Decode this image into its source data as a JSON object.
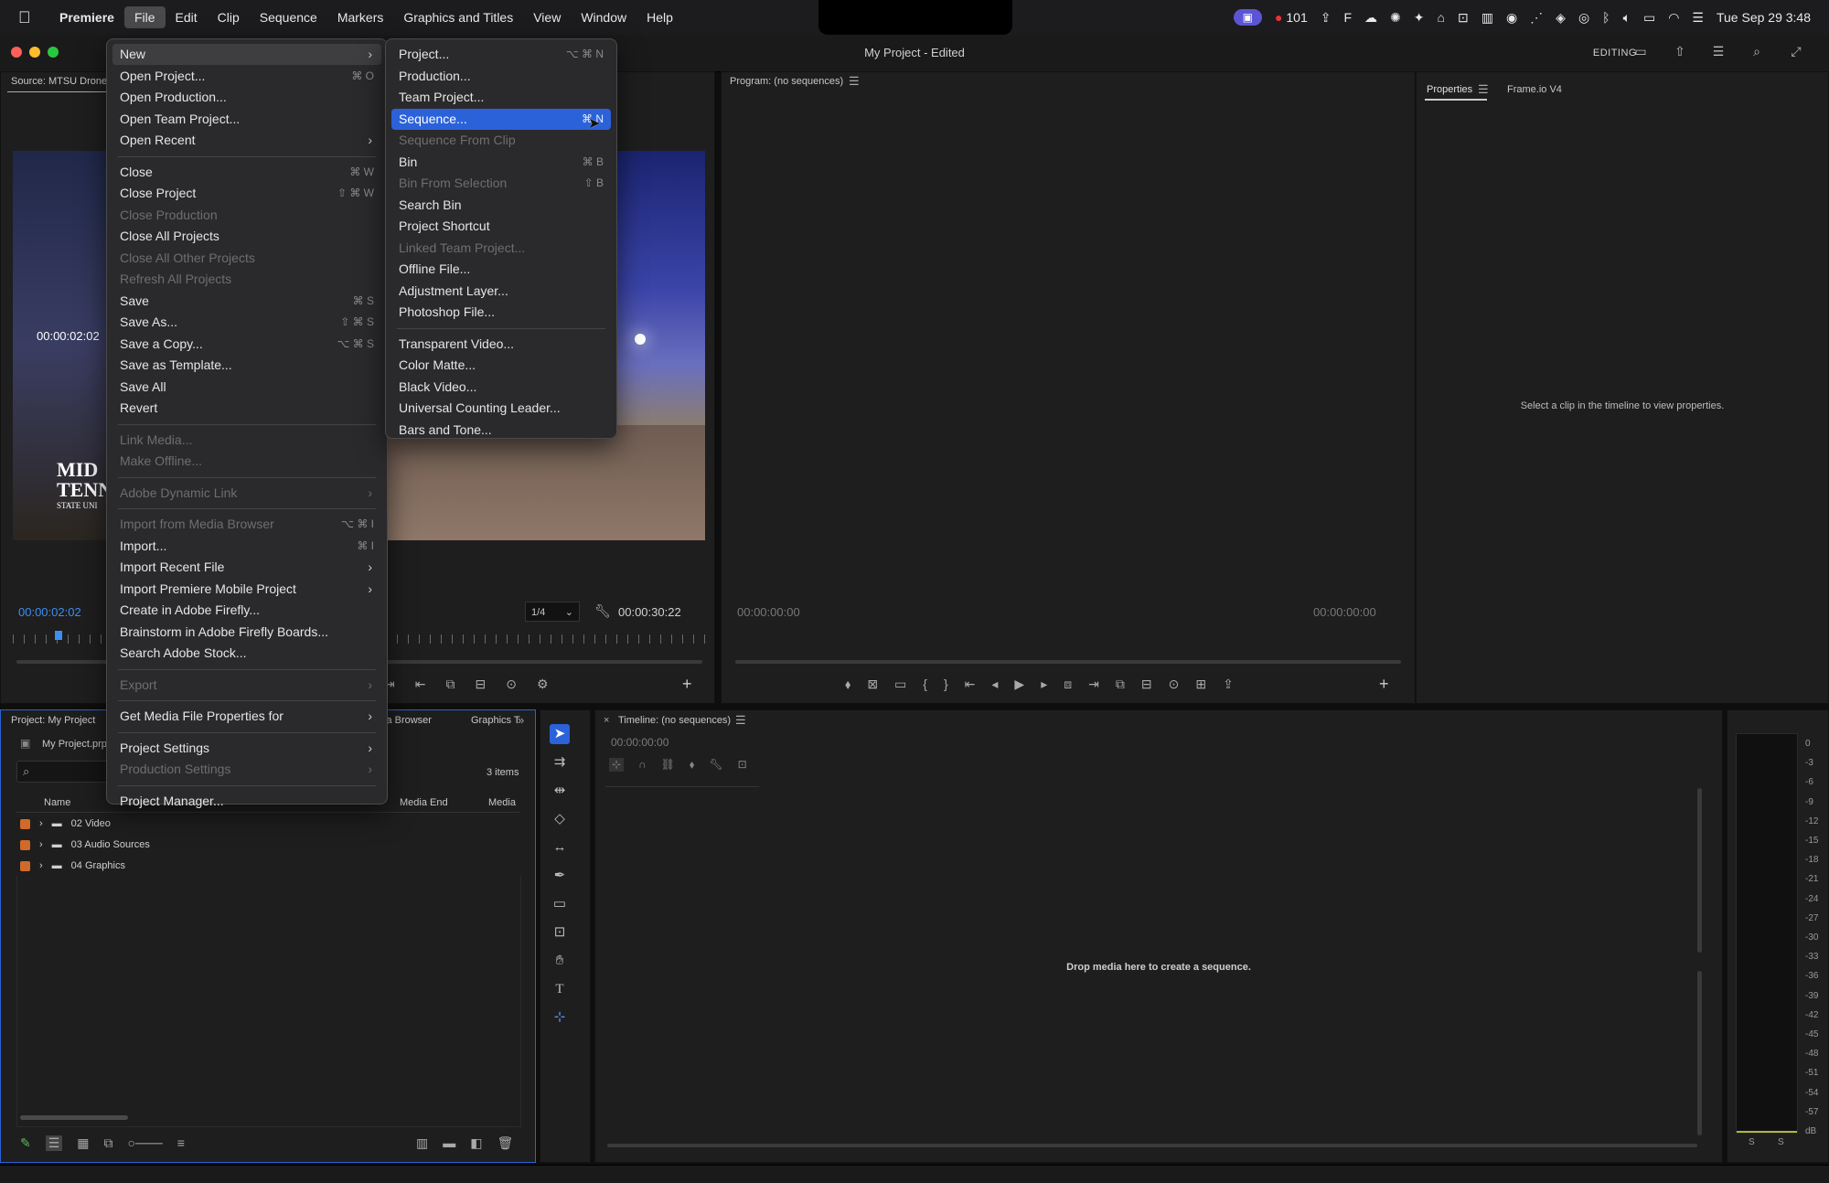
{
  "menubar": {
    "app": "Premiere",
    "items": [
      "File",
      "Edit",
      "Clip",
      "Sequence",
      "Markers",
      "Graphics and Titles",
      "View",
      "Window",
      "Help"
    ],
    "active": "File",
    "status": {
      "rec_count": "101",
      "datetime": "Tue Sep 29  3:48"
    }
  },
  "window": {
    "title": "My Project - Edited",
    "workspace": "EDITING"
  },
  "source_panel": {
    "tab": "Source: MTSU Drone -",
    "timecode_overlay": "00:00:02:02",
    "timecode_left": "00:00:02:02",
    "zoom": "1/4",
    "timecode_right": "00:00:30:22",
    "logo_lines": [
      "MID",
      "TENN",
      "STATE UNI"
    ]
  },
  "program_panel": {
    "tab": "Program: (no sequences)",
    "timecode_left": "00:00:00:00",
    "timecode_right": "00:00:00:00"
  },
  "properties_panel": {
    "tabs": [
      "Properties",
      "Frame.io V4"
    ],
    "message": "Select a clip in the timeline to view properties."
  },
  "project_panel": {
    "tab": "Project: My Project",
    "tabs_extra": [
      "ia Browser",
      "Graphics T"
    ],
    "file": "My Project.prp",
    "item_count": "3 items",
    "columns": [
      "Name",
      "Media End",
      "Media"
    ],
    "rows": [
      "02 Video",
      "03 Audio Sources",
      "04 Graphics"
    ]
  },
  "timeline_panel": {
    "tab": "Timeline: (no sequences)",
    "timecode": "00:00:00:00",
    "message": "Drop media here to create a sequence."
  },
  "audio_meter": {
    "labels": [
      "0",
      "-3",
      "-6",
      "-9",
      "-12",
      "-15",
      "-18",
      "-21",
      "-24",
      "-27",
      "-30",
      "-33",
      "-36",
      "-39",
      "-42",
      "-45",
      "-48",
      "-51",
      "-54",
      "-57",
      "dB"
    ],
    "solo": [
      "S",
      "S"
    ]
  },
  "file_menu": [
    {
      "label": "New",
      "arrow": true,
      "state": "hover"
    },
    {
      "label": "Open Project...",
      "sc": "⌘ O"
    },
    {
      "label": "Open Production..."
    },
    {
      "label": "Open Team Project..."
    },
    {
      "label": "Open Recent",
      "arrow": true
    },
    {
      "sep": true
    },
    {
      "label": "Close",
      "sc": "⌘ W"
    },
    {
      "label": "Close Project",
      "sc": "⇧ ⌘ W"
    },
    {
      "label": "Close Production",
      "dis": true
    },
    {
      "label": "Close All Projects"
    },
    {
      "label": "Close All Other Projects",
      "dis": true
    },
    {
      "label": "Refresh All Projects",
      "dis": true
    },
    {
      "label": "Save",
      "sc": "⌘ S"
    },
    {
      "label": "Save As...",
      "sc": "⇧ ⌘ S"
    },
    {
      "label": "Save a Copy...",
      "sc": "⌥ ⌘ S"
    },
    {
      "label": "Save as Template..."
    },
    {
      "label": "Save All"
    },
    {
      "label": "Revert"
    },
    {
      "sep": true
    },
    {
      "label": "Link Media...",
      "dis": true
    },
    {
      "label": "Make Offline...",
      "dis": true
    },
    {
      "sep": true
    },
    {
      "label": "Adobe Dynamic Link",
      "arrow": true,
      "dis": true
    },
    {
      "sep": true
    },
    {
      "label": "Import from Media Browser",
      "sc": "⌥ ⌘ I",
      "dis": true
    },
    {
      "label": "Import...",
      "sc": "⌘ I"
    },
    {
      "label": "Import Recent File",
      "arrow": true
    },
    {
      "label": "Import Premiere Mobile Project",
      "arrow": true
    },
    {
      "label": "Create in Adobe Firefly..."
    },
    {
      "label": "Brainstorm in Adobe Firefly Boards..."
    },
    {
      "label": "Search Adobe Stock..."
    },
    {
      "sep": true
    },
    {
      "label": "Export",
      "arrow": true,
      "dis": true
    },
    {
      "sep": true
    },
    {
      "label": "Get Media File Properties for",
      "arrow": true
    },
    {
      "sep": true
    },
    {
      "label": "Project Settings",
      "arrow": true
    },
    {
      "label": "Production Settings",
      "arrow": true,
      "dis": true
    },
    {
      "sep": true
    },
    {
      "label": "Project Manager..."
    }
  ],
  "new_submenu": [
    {
      "label": "Project...",
      "sc": "⌥ ⌘ N"
    },
    {
      "label": "Production..."
    },
    {
      "label": "Team Project..."
    },
    {
      "label": "Sequence...",
      "sc": "⌘ N",
      "state": "selected"
    },
    {
      "label": "Sequence From Clip",
      "dis": true
    },
    {
      "label": "Bin",
      "sc": "⌘ B"
    },
    {
      "label": "Bin From Selection",
      "sc": "⇧ B",
      "dis": true
    },
    {
      "label": "Search Bin"
    },
    {
      "label": "Project Shortcut"
    },
    {
      "label": "Linked Team Project...",
      "dis": true
    },
    {
      "label": "Offline File..."
    },
    {
      "label": "Adjustment Layer..."
    },
    {
      "label": "Photoshop File..."
    },
    {
      "sep": true
    },
    {
      "label": "Transparent Video..."
    },
    {
      "label": "Color Matte..."
    },
    {
      "label": "Black Video..."
    },
    {
      "label": "Universal Counting Leader..."
    },
    {
      "label": "Bars and Tone..."
    }
  ]
}
